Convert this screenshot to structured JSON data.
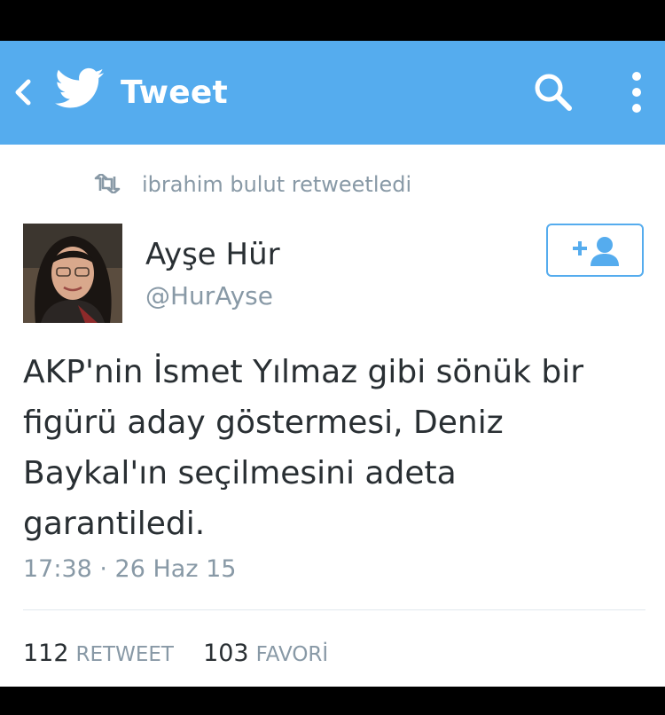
{
  "appbar": {
    "title": "Tweet",
    "background_color": "#55acee",
    "icons": [
      "back-arrow-icon",
      "twitter-bird-icon",
      "search-icon",
      "overflow-menu-icon"
    ]
  },
  "retweet_context": {
    "icon": "retweet-icon",
    "text": "ibrahim bulut retweetledi"
  },
  "author": {
    "name": "Ayşe Hür",
    "handle": "@HurAyse",
    "follow_icon": "follow-plus-person-icon"
  },
  "tweet": {
    "text": "AKP'nin İsmet Yılmaz gibi sönük bir\nfigürü aday göstermesi, Deniz\nBaykal'ın seçilmesini adeta\ngarantiledi.",
    "timestamp": "17:38 · 26 Haz 15"
  },
  "stats": {
    "retweet_count": "112",
    "retweet_label": "RETWEET",
    "favorite_count": "103",
    "favorite_label": "FAVORİ"
  }
}
